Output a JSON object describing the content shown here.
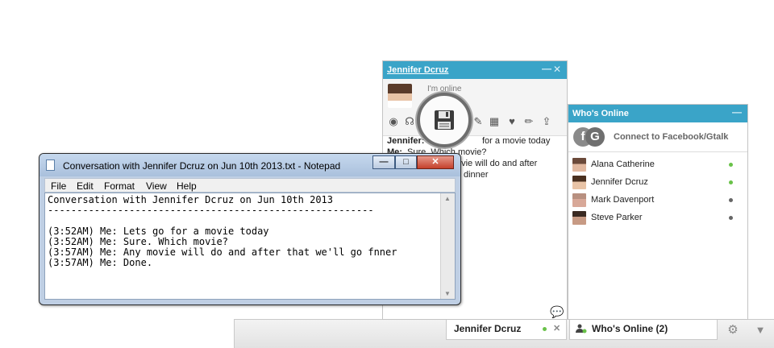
{
  "chat_window": {
    "title": "Jennifer Dcruz",
    "status": "I'm online",
    "messages": [
      {
        "sender": "Jennifer:",
        "text": "Lets go for a movie today"
      },
      {
        "sender": "Me:",
        "text": "Sure. Which movie?"
      },
      {
        "sender": "Me:",
        "text": "Any movie will do and after that we'll go for dinner"
      }
    ],
    "visible_message_fragments": [
      "for a movie today",
      "Sure. Which movie?",
      "ovie will do and after",
      "dinner"
    ]
  },
  "whos_online": {
    "title": "Who's Online",
    "connect_label": "Connect to Facebook/Gtalk",
    "contacts": [
      {
        "name": "Alana Catherine",
        "status": "online",
        "status_color": "#69c249"
      },
      {
        "name": "Jennifer Dcruz",
        "status": "online",
        "status_color": "#69c249"
      },
      {
        "name": "Mark Davenport",
        "status": "offline",
        "status_color": "#666666"
      },
      {
        "name": "Steve Parker",
        "status": "offline",
        "status_color": "#666666"
      }
    ]
  },
  "bottom_bar": {
    "chat_tab": "Jennifer Dcruz",
    "whos_online_tab": "Who's Online (2)"
  },
  "notepad": {
    "title": "Conversation with Jennifer Dcruz on Jun 10th 2013.txt - Notepad",
    "menu": [
      "File",
      "Edit",
      "Format",
      "View",
      "Help"
    ],
    "lines": [
      "Conversation with Jennifer Dcruz on Jun 10th 2013",
      "--------------------------------------------------------",
      "",
      "(3:52AM) Me: Lets go for a movie today",
      "(3:52AM) Me: Sure. Which movie?",
      "(3:57AM) Me: Any movie will do and after that we'll go fnner",
      "(3:57AM) Me: Done."
    ]
  },
  "colors": {
    "header_blue": "#3aa4c8",
    "online_green": "#69c249"
  }
}
